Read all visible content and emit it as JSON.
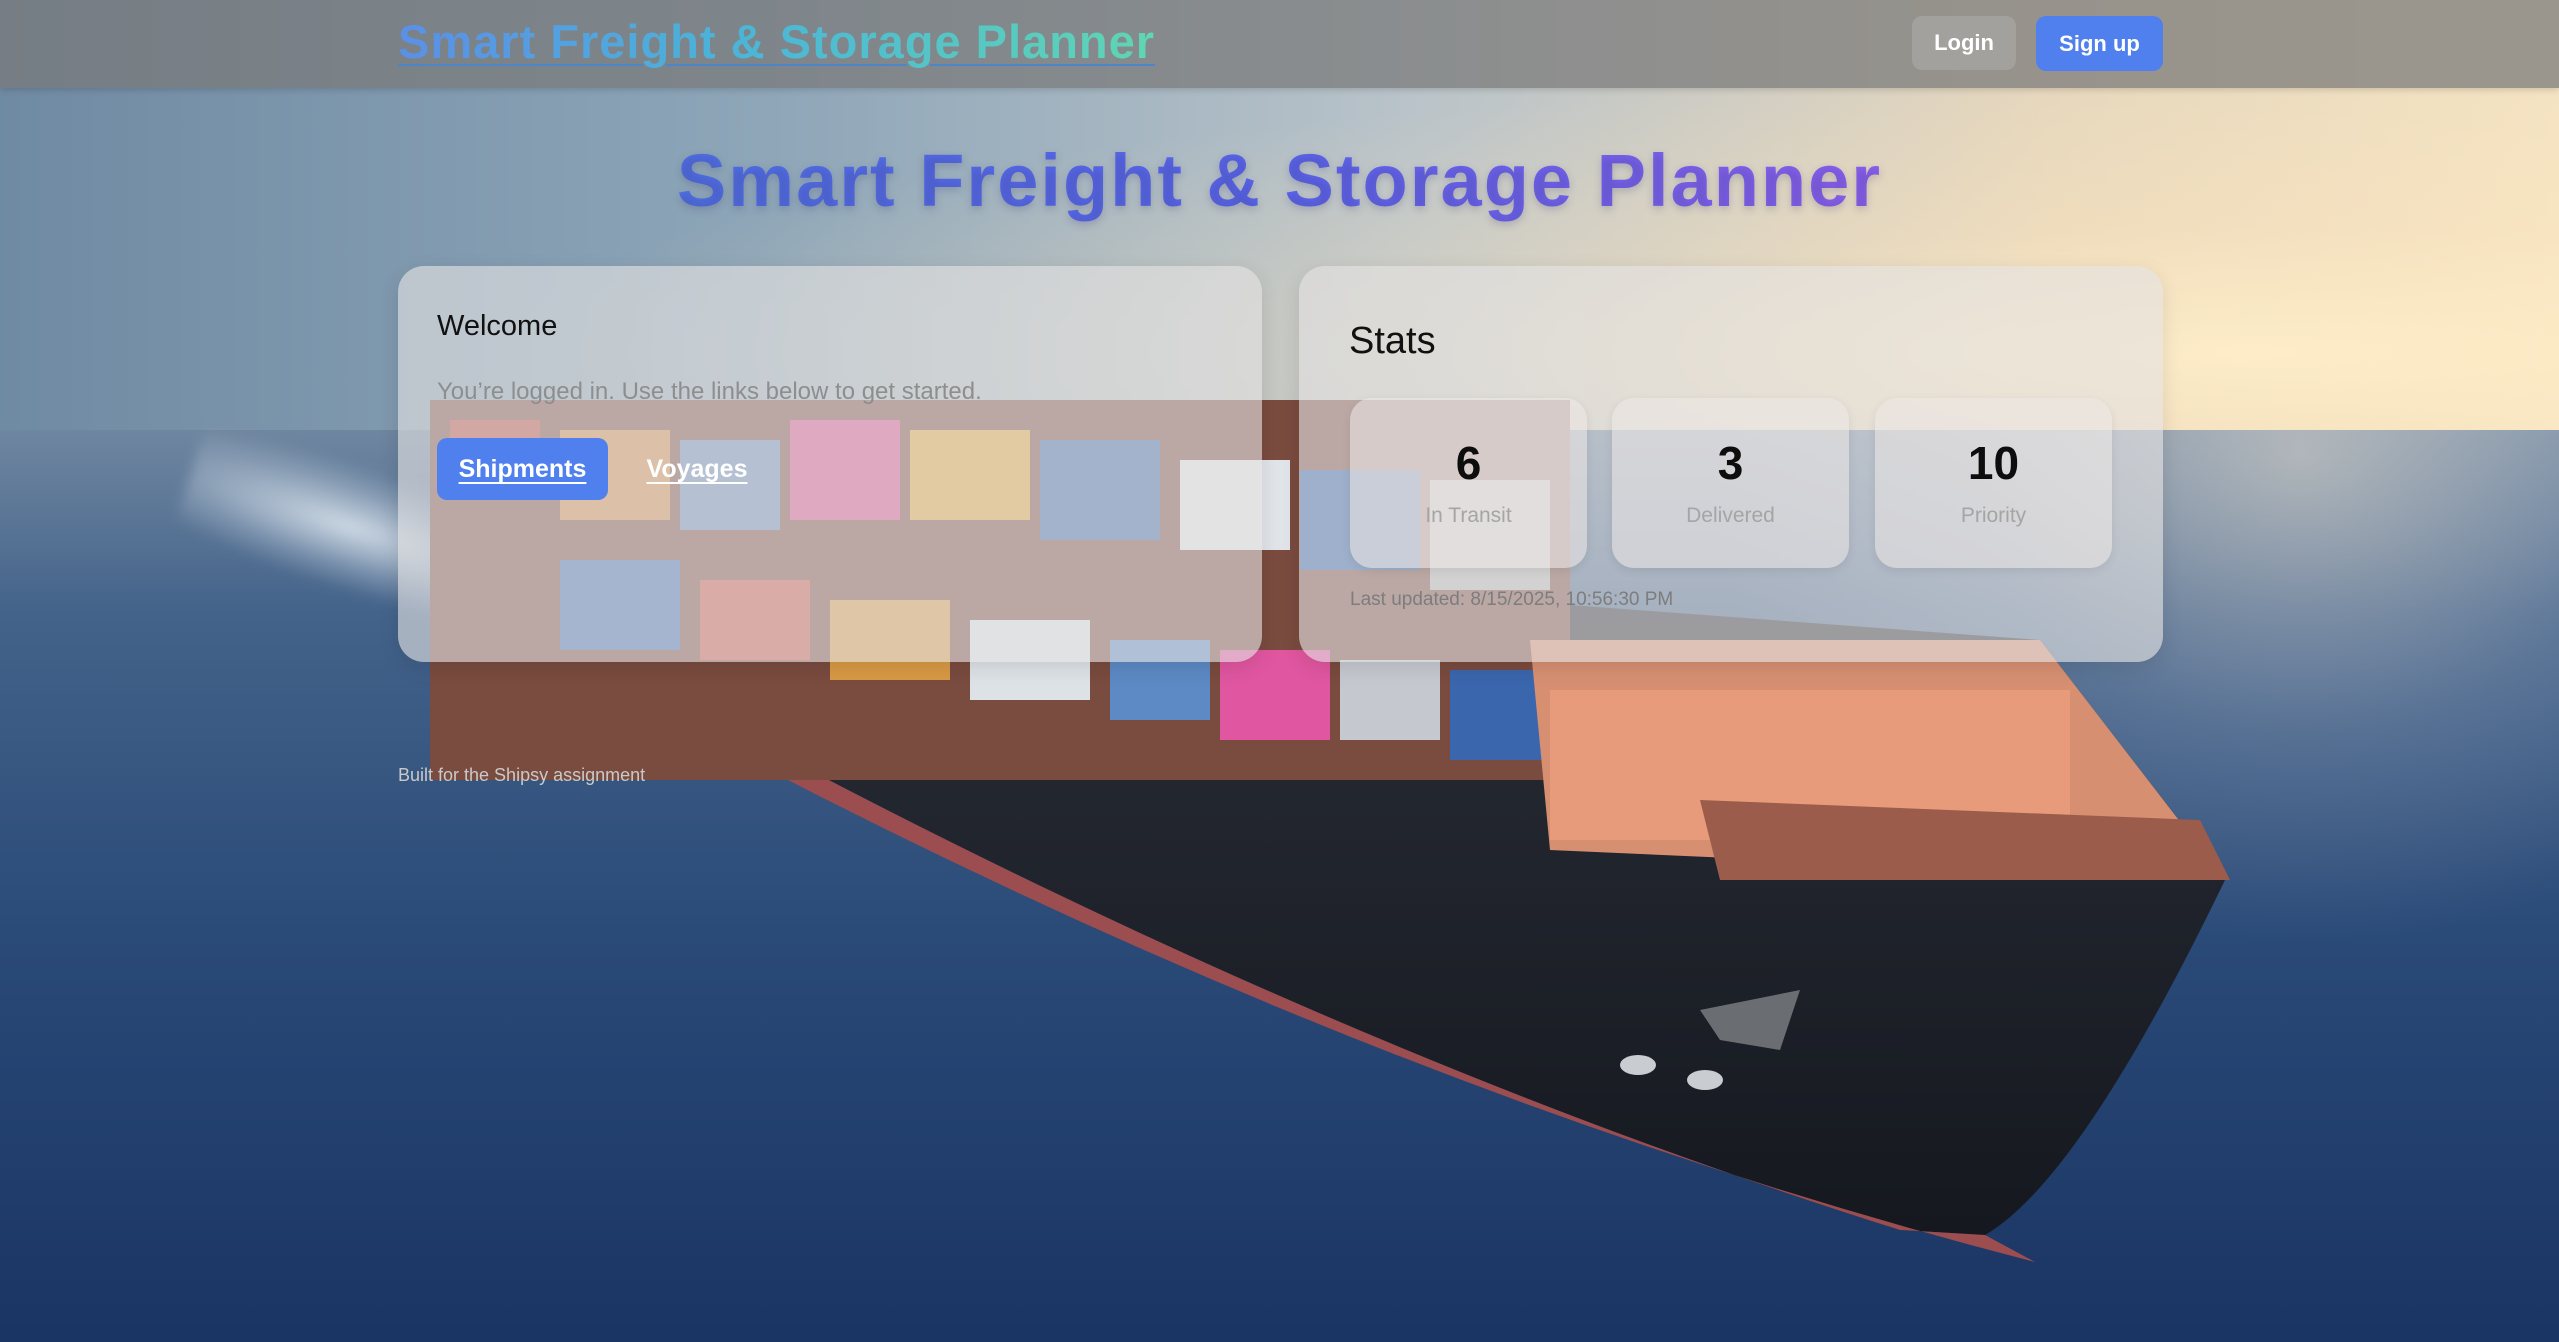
{
  "nav": {
    "brand": "Smart Freight & Storage Planner",
    "login_label": "Login",
    "signup_label": "Sign up"
  },
  "hero": {
    "title": "Smart Freight & Storage Planner"
  },
  "welcome": {
    "title": "Welcome",
    "text": "You’re logged in. Use the links below to get started.",
    "shipments_label": "Shipments",
    "voyages_label": "Voyages"
  },
  "stats": {
    "title": "Stats",
    "items": [
      {
        "value": "6",
        "label": "In Transit"
      },
      {
        "value": "3",
        "label": "Delivered"
      },
      {
        "value": "10",
        "label": "Priority"
      }
    ],
    "last_updated": "Last updated: 8/15/2025, 10:56:30 PM"
  },
  "footer": {
    "text": "Built for the Shipsy assignment"
  },
  "colors": {
    "primary": "#4f80ee",
    "brand_gradient_start": "#5b8fe6",
    "brand_gradient_end": "#5fd6b3",
    "hero_gradient_start": "#4f6fe4",
    "hero_gradient_end": "#8d5ff0"
  }
}
